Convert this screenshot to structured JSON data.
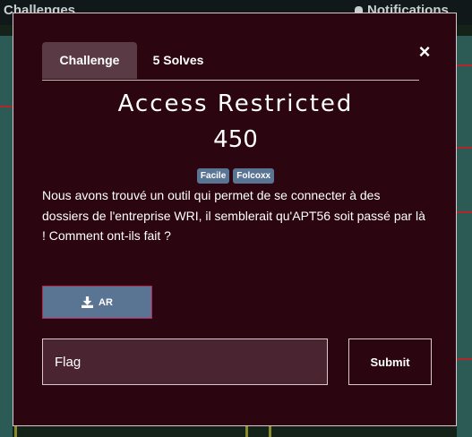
{
  "background": {
    "page_title": "Challenges",
    "notifications_label": "Notifications"
  },
  "modal": {
    "tabs": [
      {
        "label": "Challenge",
        "active": true
      },
      {
        "label": "5 Solves",
        "active": false
      }
    ],
    "close_glyph": "×",
    "title": "Access Restricted",
    "points": "450",
    "tags": [
      "Facile",
      "Folcoxx"
    ],
    "description": "Nous avons trouvé un outil qui permet de se connecter à des dossiers de l'entreprise WRI, il semblerait qu'APT56 soit passé par là ! Comment ont-ils fait ?",
    "file_button": {
      "icon": "download-icon",
      "label": "AR"
    },
    "flag_input": {
      "placeholder": "Flag",
      "value": ""
    },
    "submit_label": "Submit"
  },
  "colors": {
    "modal_bg": "#2b0510",
    "tag_bg": "#5a7494",
    "file_button_border": "#b3265a",
    "active_tab_bg": "#5a3a44"
  }
}
